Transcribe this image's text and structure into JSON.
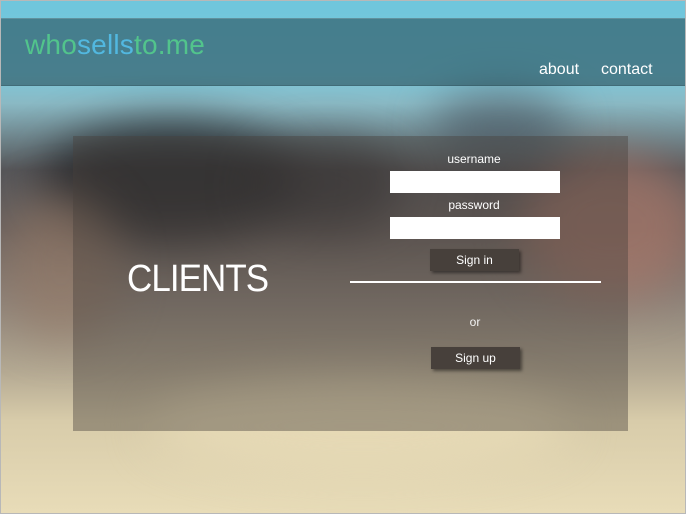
{
  "header": {
    "logo": {
      "who": "who",
      "sells": "sells",
      "to": "to",
      "me": ".me"
    },
    "nav": {
      "about": "about",
      "contact": "contact"
    }
  },
  "login": {
    "heading": "CLIENTS",
    "username_label": "username",
    "username_value": "",
    "password_label": "password",
    "password_value": "",
    "signin_label": "Sign in",
    "or_text": "or",
    "signup_label": "Sign up"
  },
  "colors": {
    "logo_green": "#52c48c",
    "logo_blue": "#52b8e0",
    "header_bg": "#285c5e",
    "button_bg": "#47403b"
  }
}
